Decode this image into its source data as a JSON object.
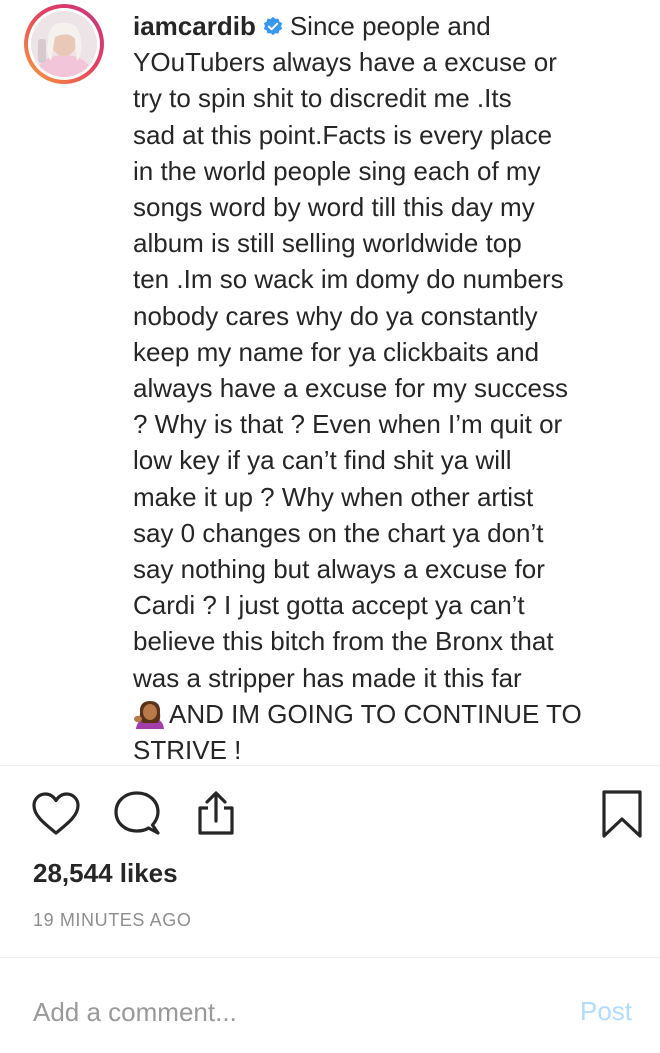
{
  "post": {
    "username": "iamcardib",
    "caption_lines": [
      "Since people and",
      "YOuTubers always have a excuse or",
      "try to spin shit to discredit me .Its",
      "sad at this point.Facts is every place",
      "in the world people sing each of my",
      "songs word by word till this day my",
      "album is still selling worldwide top",
      "ten .Im so wack im domy do numbers",
      "nobody cares why do ya constantly",
      "keep my name for ya clickbaits and",
      "always have a excuse for my success",
      "? Why is that ? Even when I’m quit or",
      "low key if ya can’t find shit ya will",
      "make it up ? Why when other artist",
      "say 0 changes on the chart ya don’t",
      "say nothing but always a excuse for",
      "Cardi ? I just gotta accept ya can’t",
      "believe this bitch from the Bronx that",
      "was a stripper has made it this far",
      "AND IM GOING TO CONTINUE TO",
      "STRIVE !"
    ],
    "likes": "28,544 likes",
    "timestamp": "19 MINUTES AGO"
  },
  "comment_box": {
    "placeholder": "Add a comment...",
    "post_label": "Post"
  },
  "icons": {
    "like": "heart-icon",
    "comment": "speech-bubble-icon",
    "share": "share-icon",
    "save": "bookmark-icon",
    "verified": "verified-badge-icon",
    "emoji": "woman-tipping-hand-emoji-icon"
  },
  "colors": {
    "text": "#262626",
    "secondary_text": "#8e8e8e",
    "verified": "#3897f0",
    "post_button_disabled": "#b3dbff",
    "divider": "#efefef"
  }
}
